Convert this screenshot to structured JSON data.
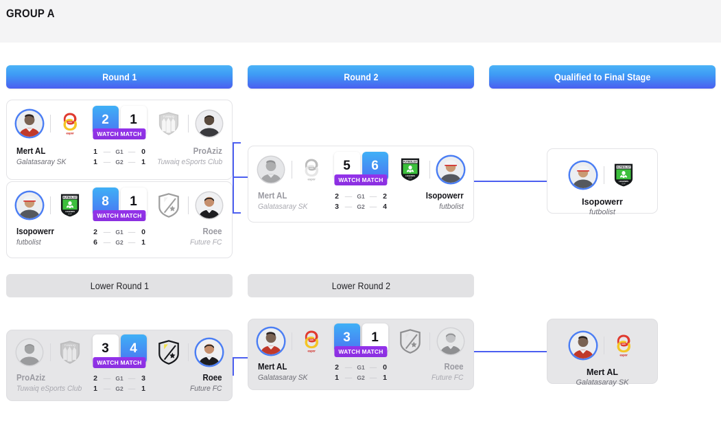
{
  "group": {
    "title": "GROUP A"
  },
  "headers": {
    "round1": "Round 1",
    "round2": "Round 2",
    "qualified": "Qualified to Final Stage",
    "lower_round1": "Lower Round 1",
    "lower_round2": "Lower Round 2"
  },
  "watch_label": "WATCH MATCH",
  "goal_labels": {
    "g1": "G1",
    "g2": "G2",
    "dash": "—"
  },
  "colors": {
    "header_gradient_start": "#4cb3f7",
    "header_gradient_end": "#4a5ef0",
    "winner_score": "#3fb0f6",
    "watch_badge": "#9333ea",
    "connector": "#4b5ef0",
    "lower_header_bg": "#e2e2e4",
    "group_band_bg": "#f4f4f5"
  },
  "matches": {
    "r1m1": {
      "left": {
        "name": "Mert AL",
        "team": "Galatasaray SK",
        "score": "2",
        "winner": true,
        "avatar": "player-mert",
        "logo": "galatasaray-espor-logo"
      },
      "right": {
        "name": "ProAziz",
        "team": "Tuwaiq eSports Club",
        "score": "1",
        "winner": false,
        "avatar": "player-proaziz",
        "logo": "tuwaiq-esports-logo"
      },
      "games": [
        {
          "label": "G1",
          "left": "1",
          "right": "0"
        },
        {
          "label": "G2",
          "left": "1",
          "right": "1"
        }
      ]
    },
    "r1m2": {
      "left": {
        "name": "Isopowerr",
        "team": "futbolist",
        "score": "8",
        "winner": true,
        "avatar": "player-isopowerr",
        "logo": "futbolist-logo"
      },
      "right": {
        "name": "Roee",
        "team": "Future FC",
        "score": "1",
        "winner": false,
        "avatar": "player-roee",
        "logo": "future-fc-logo"
      },
      "games": [
        {
          "label": "G1",
          "left": "2",
          "right": "0"
        },
        {
          "label": "G2",
          "left": "6",
          "right": "1"
        }
      ]
    },
    "r2m1": {
      "left": {
        "name": "Mert AL",
        "team": "Galatasaray SK",
        "score": "5",
        "winner": false,
        "avatar": "player-mert",
        "logo": "galatasaray-espor-logo"
      },
      "right": {
        "name": "Isopowerr",
        "team": "futbolist",
        "score": "6",
        "winner": true,
        "avatar": "player-isopowerr",
        "logo": "futbolist-logo"
      },
      "games": [
        {
          "label": "G1",
          "left": "2",
          "right": "2"
        },
        {
          "label": "G2",
          "left": "3",
          "right": "4"
        }
      ]
    },
    "lr1m1": {
      "left": {
        "name": "ProAziz",
        "team": "Tuwaiq eSports Club",
        "score": "3",
        "winner": false,
        "avatar": "player-proaziz",
        "logo": "tuwaiq-esports-logo"
      },
      "right": {
        "name": "Roee",
        "team": "Future FC",
        "score": "4",
        "winner": true,
        "avatar": "player-roee",
        "logo": "future-fc-logo"
      },
      "games": [
        {
          "label": "G1",
          "left": "2",
          "right": "3"
        },
        {
          "label": "G2",
          "left": "1",
          "right": "1"
        }
      ]
    },
    "lr2m1": {
      "left": {
        "name": "Mert AL",
        "team": "Galatasaray SK",
        "score": "3",
        "winner": true,
        "avatar": "player-mert",
        "logo": "galatasaray-espor-logo"
      },
      "right": {
        "name": "Roee",
        "team": "Future FC",
        "score": "1",
        "winner": false,
        "avatar": "player-roee",
        "logo": "future-fc-logo"
      },
      "games": [
        {
          "label": "G1",
          "left": "2",
          "right": "0"
        },
        {
          "label": "G2",
          "left": "1",
          "right": "1"
        }
      ]
    }
  },
  "qualified": {
    "upper": {
      "name": "Isopowerr",
      "team": "futbolist",
      "avatar": "player-isopowerr",
      "logo": "futbolist-logo"
    },
    "lower": {
      "name": "Mert AL",
      "team": "Galatasaray SK",
      "avatar": "player-mert",
      "logo": "galatasaray-espor-logo"
    }
  }
}
